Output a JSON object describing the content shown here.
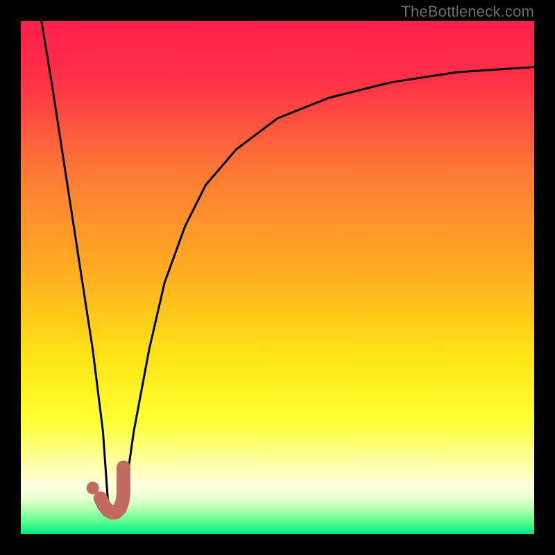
{
  "watermark": {
    "text": "TheBottleneck.com"
  },
  "palette": {
    "background": "#000000",
    "gradient_stops": [
      {
        "offset": 0.0,
        "color": "#ff1f4c"
      },
      {
        "offset": 0.12,
        "color": "#ff3248"
      },
      {
        "offset": 0.3,
        "color": "#ff7b35"
      },
      {
        "offset": 0.5,
        "color": "#ffb020"
      },
      {
        "offset": 0.66,
        "color": "#ffe615"
      },
      {
        "offset": 0.78,
        "color": "#ffff33"
      },
      {
        "offset": 0.86,
        "color": "#ffffa5"
      },
      {
        "offset": 0.905,
        "color": "#ffffe0"
      },
      {
        "offset": 0.93,
        "color": "#e8ffd0"
      },
      {
        "offset": 0.95,
        "color": "#b6ffb0"
      },
      {
        "offset": 0.975,
        "color": "#5cff90"
      },
      {
        "offset": 1.0,
        "color": "#00e884"
      }
    ],
    "curve_color": "#000000",
    "marker_color": "#c26a60"
  },
  "chart_data": {
    "type": "line",
    "title": "",
    "xlabel": "",
    "ylabel": "",
    "xlim": [
      0,
      100
    ],
    "ylim": [
      0,
      100
    ],
    "series": [
      {
        "name": "left-branch",
        "x": [
          4,
          6,
          8,
          10,
          12,
          14,
          16,
          17
        ],
        "values": [
          100,
          88,
          75,
          62,
          49,
          36,
          20,
          6
        ]
      },
      {
        "name": "right-branch",
        "x": [
          20,
          22,
          25,
          28,
          32,
          36,
          42,
          50,
          60,
          72,
          85,
          100
        ],
        "values": [
          6,
          20,
          36,
          49,
          60,
          68,
          75,
          81,
          85,
          88,
          90,
          91
        ]
      }
    ],
    "marker": {
      "name": "J-marker",
      "x": [
        15.5,
        16.2,
        17.0,
        17.8,
        18.6,
        19.3,
        19.8,
        20.0,
        20.0,
        20.0,
        20.0
      ],
      "values": [
        7.0,
        5.6,
        4.6,
        4.2,
        4.3,
        5.0,
        6.4,
        8.0,
        9.8,
        11.6,
        13.0
      ]
    },
    "marker_dot": {
      "x": 14.0,
      "y": 9.0
    }
  }
}
